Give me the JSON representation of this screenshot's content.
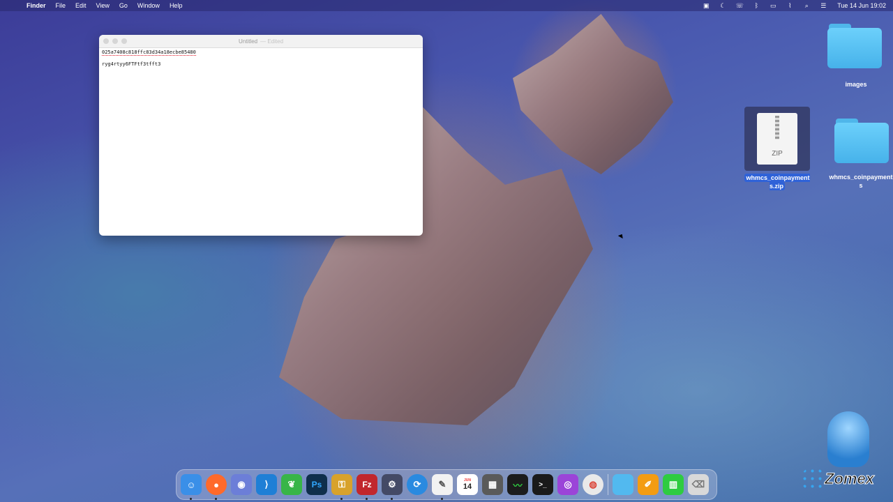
{
  "menubar": {
    "app_name": "Finder",
    "menus": [
      "File",
      "Edit",
      "View",
      "Go",
      "Window",
      "Help"
    ],
    "clock": "Tue 14 Jun  19:02"
  },
  "editor": {
    "title": "Untitled",
    "title_suffix": "— Edited",
    "lines": [
      "025a7408c818ffc83d34a18ecbe85480",
      "ryg4rtyy6FTFtf3tfft3"
    ]
  },
  "desktop": {
    "items": [
      {
        "label": "images",
        "kind": "folder"
      },
      {
        "label": "whmcs_coinpayments.zip",
        "kind": "zip",
        "badge": "ZIP",
        "selected": true
      },
      {
        "label": "whmcs_coinpayments",
        "kind": "folder"
      }
    ]
  },
  "dock": {
    "apps": [
      {
        "name": "finder",
        "color": "#3a8fe8",
        "glyph": "☺"
      },
      {
        "name": "firefox",
        "color": "#ff6a2b",
        "glyph": "●"
      },
      {
        "name": "github-desktop",
        "color": "#6c7ed8",
        "glyph": "◉"
      },
      {
        "name": "vscode",
        "color": "#1f7fd6",
        "glyph": "⟩"
      },
      {
        "name": "coda-leaf",
        "color": "#38b548",
        "glyph": "❦"
      },
      {
        "name": "photoshop",
        "color": "#0f2f4c",
        "glyph": "Ps"
      },
      {
        "name": "keychain",
        "color": "#d8a22b",
        "glyph": "⚿"
      },
      {
        "name": "filezilla",
        "color": "#c1272d",
        "glyph": "Fz"
      },
      {
        "name": "sequel-pro",
        "color": "#444a66",
        "glyph": "⚙"
      },
      {
        "name": "sync",
        "color": "#2a8ae0",
        "glyph": "⟳"
      },
      {
        "name": "textedit",
        "color": "#f2f2f2",
        "glyph": "✎"
      },
      {
        "name": "calendar",
        "color": "#ffffff",
        "glyph": "14"
      },
      {
        "name": "calculator",
        "color": "#5a5a5a",
        "glyph": "▦"
      },
      {
        "name": "activity-monitor",
        "color": "#1c1c1c",
        "glyph": "〰"
      },
      {
        "name": "terminal",
        "color": "#1a1a1a",
        "glyph": ">_"
      },
      {
        "name": "podcasts",
        "color": "#9b44d8",
        "glyph": "◎"
      },
      {
        "name": "chrome",
        "color": "#e9e9e9",
        "glyph": "◍"
      },
      {
        "name": "downloads-folder",
        "color": "#52b9ef",
        "glyph": ""
      },
      {
        "name": "pages",
        "color": "#f39c12",
        "glyph": "✐"
      },
      {
        "name": "numbers",
        "color": "#2ecc40",
        "glyph": "▥"
      },
      {
        "name": "trash",
        "color": "#d9d9d9",
        "glyph": "🗑"
      }
    ],
    "calendar_month": "JUN"
  },
  "branding": {
    "logo_text": "Zomex"
  }
}
